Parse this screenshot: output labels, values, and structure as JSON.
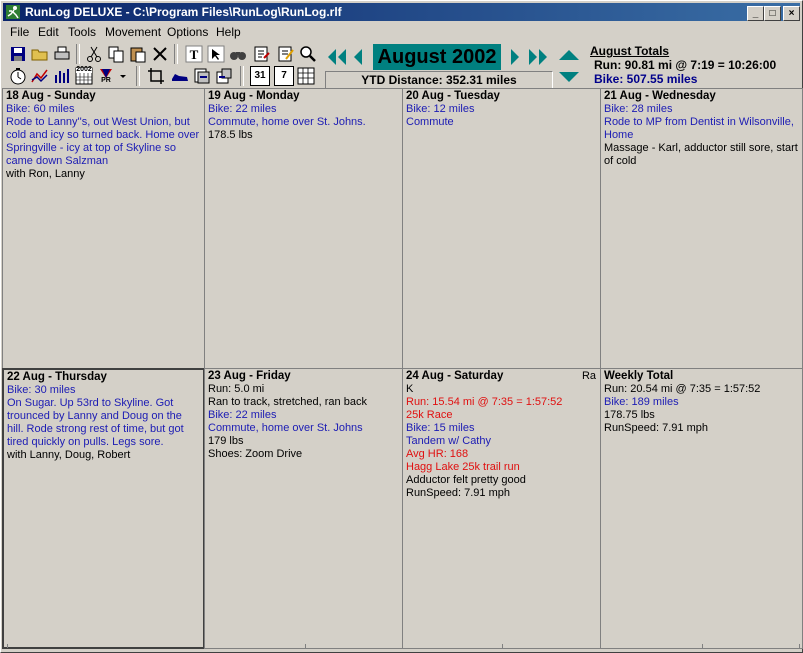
{
  "window": {
    "title": "RunLog DELUXE - C:\\Program Files\\RunLog\\RunLog.rlf",
    "minimize_icon": "_",
    "maximize_icon": "□",
    "close_icon": "×"
  },
  "menu": [
    "File",
    "Edit",
    "Tools",
    "Movement",
    "Options",
    "Help"
  ],
  "toolbar": {
    "row1_icons": [
      "save-icon",
      "open-icon",
      "print-icon",
      "cut-icon",
      "copy-icon",
      "paste-icon",
      "delete-icon",
      "text-icon",
      "select-icon",
      "find-icon",
      "edit-entry-icon",
      "edit-note-icon",
      "search-icon"
    ],
    "row2_icons": [
      "stopwatch-icon",
      "graph-icon",
      "bar-chart-icon",
      "calendar-2002-icon",
      "pr-icon",
      "dropdown-icon",
      "crop-icon",
      "shoe-icon",
      "export-icon",
      "import-icon",
      "day-view-icon",
      "week-view-icon",
      "month-view-icon"
    ],
    "year_badge": "2002",
    "pr_badge": "PR",
    "day_badge": "31",
    "week_badge": "7"
  },
  "nav": {
    "month_label": "August 2002",
    "ytd_label": "YTD Distance: 352.31 miles"
  },
  "totals": {
    "title": "August Totals",
    "run": "Run: 90.81 mi @ 7:19 = 10:26:00",
    "bike": "Bike: 507.55 miles"
  },
  "week": [
    {
      "header": "18 Aug - Sunday",
      "lines": [
        {
          "text": "Bike: 60 miles",
          "color": "blue"
        },
        {
          "text": "Rode to Lanny''s, out West Union, but cold and icy so turned back.  Home over Springville - icy at top of Skyline so came down Salzman",
          "color": "blue"
        },
        {
          "text": "with Ron, Lanny",
          "color": "black"
        }
      ]
    },
    {
      "header": "19 Aug - Monday",
      "lines": [
        {
          "text": "Bike: 22 miles",
          "color": "blue"
        },
        {
          "text": "Commute, home over St. Johns.",
          "color": "blue"
        },
        {
          "text": "178.5 lbs",
          "color": "black"
        }
      ]
    },
    {
      "header": "20 Aug - Tuesday",
      "lines": [
        {
          "text": "Bike: 12 miles",
          "color": "blue"
        },
        {
          "text": "Commute",
          "color": "blue"
        }
      ]
    },
    {
      "header": "21 Aug - Wednesday",
      "lines": [
        {
          "text": "Bike: 28 miles",
          "color": "blue"
        },
        {
          "text": "Rode to MP from Dentist in Wilsonville, Home",
          "color": "blue"
        },
        {
          "text": "Massage - Karl, adductor still sore, start of cold",
          "color": "black"
        }
      ]
    },
    {
      "header": "22 Aug - Thursday",
      "lines": [
        {
          "text": "Bike: 30 miles",
          "color": "blue"
        },
        {
          "text": "On Sugar.  Up 53rd to Skyline.  Got trounced by Lanny and Doug on the hill.  Rode strong rest of time, but got tired quickly on pulls.  Legs sore.",
          "color": "blue"
        },
        {
          "text": "with Lanny, Doug, Robert",
          "color": "black"
        }
      ]
    },
    {
      "header": "23 Aug - Friday",
      "lines": [
        {
          "text": "Run: 5.0 mi",
          "color": "black"
        },
        {
          "text": "Ran to track, stretched, ran back",
          "color": "black"
        },
        {
          "text": "Bike: 22 miles",
          "color": "blue"
        },
        {
          "text": "Commute, home over St. Johns",
          "color": "blue"
        },
        {
          "text": "179 lbs",
          "color": "black"
        },
        {
          "text": "Shoes: Zoom Drive",
          "color": "black"
        }
      ]
    },
    {
      "header": "24 Aug - Saturday",
      "corner": "Ra",
      "lines": [
        {
          "text": "K",
          "color": "black"
        },
        {
          "text": "Run: 15.54 mi @ 7:35 = 1:57:52",
          "color": "red"
        },
        {
          "text": "25k Race",
          "color": "red"
        },
        {
          "text": "Bike: 15 miles",
          "color": "blue"
        },
        {
          "text": "Tandem w/ Cathy",
          "color": "blue"
        },
        {
          "text": "Avg HR: 168",
          "color": "red"
        },
        {
          "text": "Hagg Lake 25k trail run",
          "color": "red"
        },
        {
          "text": "Adductor felt pretty good",
          "color": "black"
        },
        {
          "text": "RunSpeed: 7.91 mph",
          "color": "black"
        }
      ]
    },
    {
      "header": "Weekly Total",
      "lines": [
        {
          "text": "Run: 20.54 mi @ 7:35 = 1:57:52",
          "color": "black"
        },
        {
          "text": "Bike: 189 miles",
          "color": "blue"
        },
        {
          "text": "178.75 lbs",
          "color": "black"
        },
        {
          "text": "RunSpeed: 7.91 mph",
          "color": "black"
        }
      ]
    }
  ]
}
